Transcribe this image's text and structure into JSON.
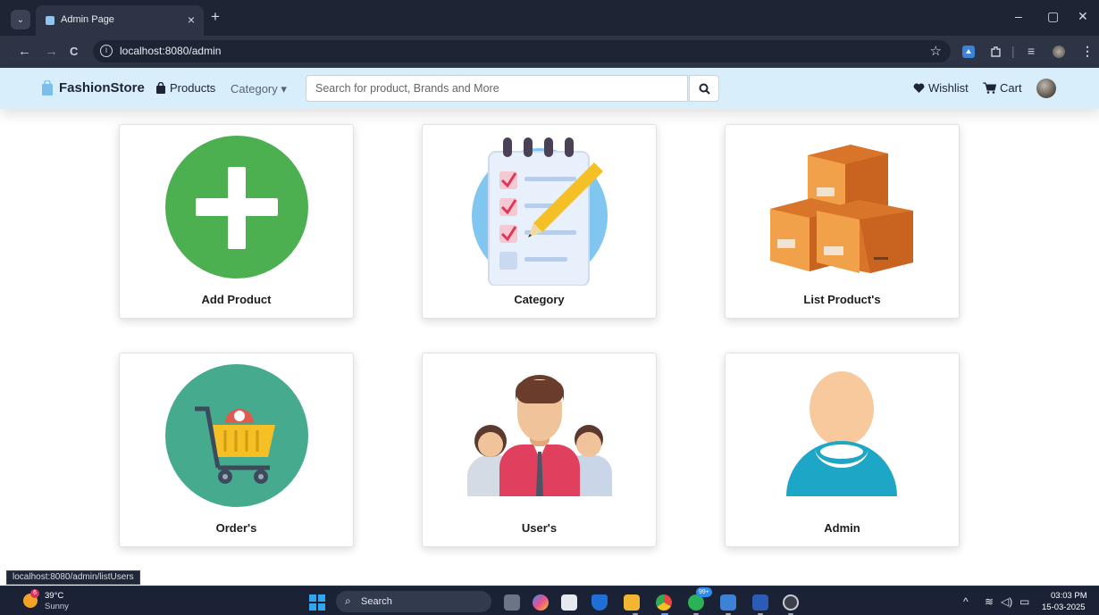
{
  "browser": {
    "tab_title": "Admin Page",
    "tab_close": "×",
    "new_tab": "+",
    "tab_list": "⌄",
    "url": "localhost:8080/admin",
    "status_url": "localhost:8080/admin/listUsers",
    "controls": {
      "minimize": "–",
      "restore": "▢",
      "close": "✕"
    },
    "nav": {
      "back": "←",
      "forward": "→",
      "reload": "C"
    }
  },
  "site": {
    "brand": "FashionStore",
    "nav_products": "Products",
    "nav_category": "Category",
    "category_caret": "▾",
    "search_placeholder": "Search for product, Brands and More",
    "wishlist": "Wishlist",
    "cart": "Cart"
  },
  "cards": [
    {
      "label": "Add Product",
      "icon": "plus-circle-icon",
      "color": "#4caf50"
    },
    {
      "label": "Category",
      "icon": "checklist-icon",
      "color": "#81c6f0"
    },
    {
      "label": "List Product's",
      "icon": "boxes-icon",
      "color": "#e9872f"
    },
    {
      "label": "Order's",
      "icon": "shopping-cart-icon",
      "color": "#46ab8e"
    },
    {
      "label": "User's",
      "icon": "users-group-icon",
      "color": "#e35772"
    },
    {
      "label": "Admin",
      "icon": "admin-user-icon",
      "color": "#1ea6c6"
    }
  ],
  "taskbar": {
    "weather_temp": "39°C",
    "weather_desc": "Sunny",
    "weather_badge": "6",
    "search_label": "Search",
    "whatsapp_badge": "99+",
    "time": "03:03 PM",
    "date": "15-03-2025"
  }
}
